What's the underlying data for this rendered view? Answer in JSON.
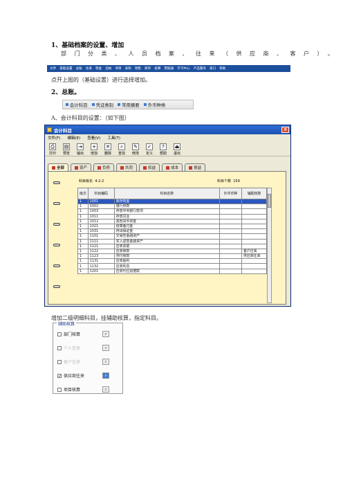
{
  "section1": {
    "heading": "1、基础档案的设置、增加",
    "subline": "部门分类、人员档案、往来（供应商、客户）。"
  },
  "menubar": {
    "items": [
      "文件",
      "基础设置",
      "总账",
      "往来",
      "现金",
      "出纳",
      "项目",
      "采购",
      "销售",
      "库存",
      "核算",
      "票据通",
      "学习中心",
      "产品服务",
      "窗口",
      "帮助"
    ]
  },
  "para1": "点开上图的（基础设置）进行选择增加。",
  "section2": {
    "heading": "2、总账。",
    "items": [
      "会计科目",
      "凭证类别",
      "常用摘要",
      "外币种类"
    ]
  },
  "para2": "A、会计科目的设置：（如下图）",
  "window": {
    "title": "会计科目",
    "menu": [
      "文件(F)",
      "编辑(E)",
      "查看(V)",
      "工具(T)"
    ],
    "toolbar": [
      "打印",
      "预览",
      "输出",
      "增加",
      "删除",
      "查找",
      "修改",
      "定义",
      "帮助",
      "退出"
    ],
    "tabs": [
      "全部",
      "资产",
      "负债",
      "共同",
      "权益",
      "成本",
      "损益"
    ],
    "code_length_label": "科目级长",
    "code_length": "4-2-2",
    "count_label": "科目个数",
    "count": "159",
    "columns": [
      "级次",
      "科目编码",
      "科目名称",
      "外币币种",
      "辅助核算"
    ],
    "rows": [
      [
        "1",
        "1001",
        "库存现金",
        "",
        ""
      ],
      [
        "1",
        "1002",
        "银行存款",
        "",
        ""
      ],
      [
        "1",
        "1003",
        "存放中央银行款项",
        "",
        ""
      ],
      [
        "1",
        "1011",
        "存放同业",
        "",
        ""
      ],
      [
        "1",
        "1012",
        "其他货币资金",
        "",
        ""
      ],
      [
        "1",
        "1021",
        "结算备付金",
        "",
        ""
      ],
      [
        "1",
        "1031",
        "存出保证金",
        "",
        ""
      ],
      [
        "1",
        "1101",
        "交易性金融资产",
        "",
        ""
      ],
      [
        "1",
        "1111",
        "买入返售金融资产",
        "",
        ""
      ],
      [
        "1",
        "1121",
        "应收票据",
        "",
        ""
      ],
      [
        "1",
        "1122",
        "应收账款",
        "",
        "客户往来"
      ],
      [
        "1",
        "1123",
        "预付账款",
        "",
        "供应商往来"
      ],
      [
        "1",
        "1131",
        "应收股利",
        "",
        ""
      ],
      [
        "1",
        "1132",
        "应收利息",
        "",
        ""
      ],
      [
        "1",
        "1201",
        "应收代位追偿款",
        "",
        ""
      ]
    ]
  },
  "para3": "增加二级明细科目，挂辅助核算，指定科目。",
  "aux": {
    "title": "辅助核算",
    "items": [
      {
        "label": "部门核算",
        "checked": false,
        "disabled": false
      },
      {
        "label": "个人往来",
        "checked": false,
        "disabled": true
      },
      {
        "label": "客户往来",
        "checked": false,
        "disabled": true
      },
      {
        "label": "供应商往来",
        "checked": true,
        "disabled": false
      },
      {
        "label": "项目核算",
        "checked": false,
        "disabled": false
      }
    ]
  }
}
